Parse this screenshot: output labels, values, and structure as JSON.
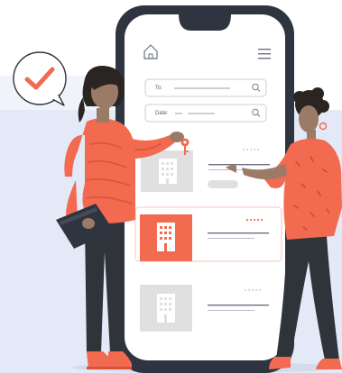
{
  "app": {
    "search_form": {
      "to_label": "To:",
      "date_label": "Date:"
    },
    "results": [
      {
        "name": "hotel-result-1",
        "state": "default"
      },
      {
        "name": "hotel-result-2",
        "state": "selected"
      },
      {
        "name": "hotel-result-3",
        "state": "default"
      }
    ]
  },
  "colors": {
    "accent": "#F26A4F",
    "background_band": "#E3E9F6",
    "phone_frame": "#2F3540",
    "screen": "#FFFFFF",
    "placeholder_gray": "#E0E0E0",
    "skin": "#9C7A68",
    "hair": "#2B2521",
    "trousers": "#2F343B"
  },
  "icons": [
    "home-icon",
    "menu-icon",
    "search-icon",
    "checkmark-icon",
    "building-icon",
    "key-icon",
    "folder-icon"
  ]
}
